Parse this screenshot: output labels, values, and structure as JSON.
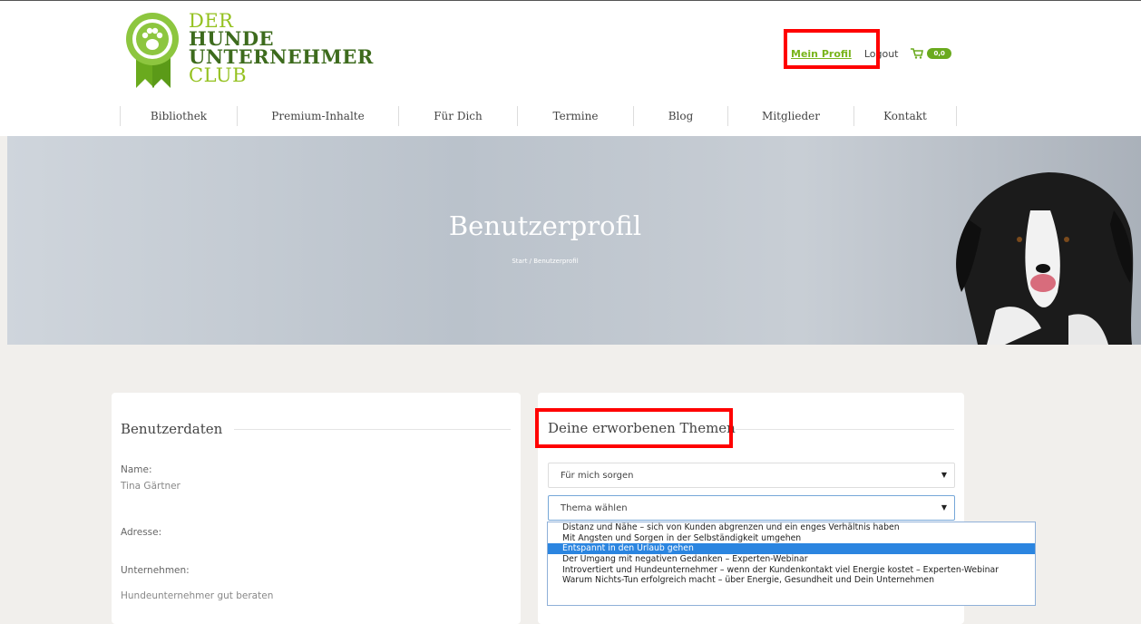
{
  "logo": {
    "line1": "DER",
    "line2": "HUNDE",
    "line3": "UNTERNEHMER",
    "line4": "CLUB",
    "icon": "paw-seal-icon"
  },
  "topnav": {
    "profile": "Mein Profil",
    "logout": "Logout",
    "cart_badge": "0,0",
    "cart_icon": "cart-icon"
  },
  "mainnav": [
    "Bibliothek",
    "Premium-Inhalte",
    "Für Dich",
    "Termine",
    "Blog",
    "Mitglieder",
    "Kontakt"
  ],
  "hero": {
    "title": "Benutzerprofil",
    "breadcrumb": "Start  /  Benutzerprofil"
  },
  "user_card": {
    "title": "Benutzerdaten",
    "name_label": "Name:",
    "name_value": "Tina Gärtner",
    "address_label": "Adresse:",
    "company_label": "Unternehmen:",
    "company_value": "Hundeunternehmer gut beraten"
  },
  "themes_card": {
    "title": "Deine erworbenen Themen",
    "category_select": "Für mich sorgen",
    "topic_select": "Thema wählen",
    "options": [
      "Distanz und Nähe – sich von Kunden abgrenzen und ein enges Verhältnis haben",
      "Mit Ängsten und Sorgen in der Selbständigkeit umgehen",
      "Entspannt in den Urlaub gehen",
      "Der Umgang mit negativen Gedanken – Experten-Webinar",
      "Introvertiert und Hundeunternehmer – wenn der Kundenkontakt viel Energie kostet – Experten-Webinar",
      "Warum Nichts-Tun erfolgreich macht – über Energie, Gesundheit und Dein Unternehmen"
    ],
    "selected_index": 2
  },
  "colors": {
    "brand_green": "#6aaa1e",
    "highlight_red": "#ff0000",
    "select_blue": "#2b85e0"
  }
}
